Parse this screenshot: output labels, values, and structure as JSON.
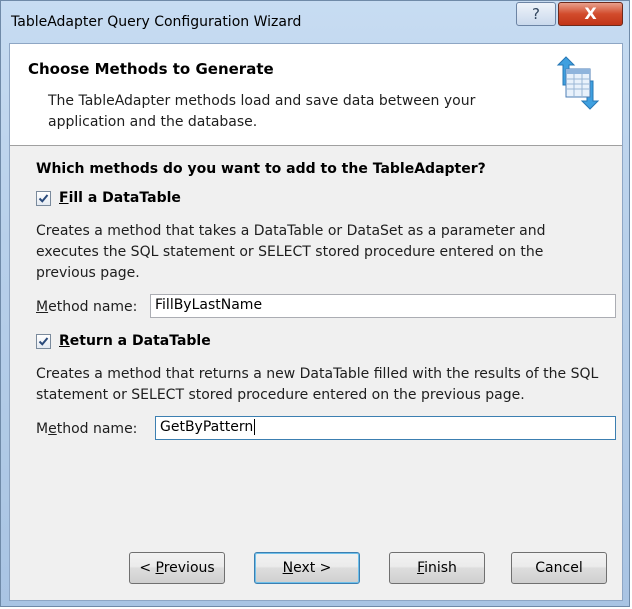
{
  "window": {
    "title": "TableAdapter Query Configuration Wizard",
    "help_glyph": "?",
    "close_glyph": "X"
  },
  "header": {
    "title": "Choose Methods to Generate",
    "description": "The TableAdapter methods load and save data between your application and the database."
  },
  "body": {
    "question": "Which methods do you want to add to the TableAdapter?",
    "fill": {
      "checked": true,
      "label_accel": "F",
      "label_rest": "ill a DataTable",
      "description": "Creates a method that takes a DataTable or DataSet as a parameter and executes the SQL statement or SELECT stored procedure entered on the previous page.",
      "method_label_accel": "M",
      "method_label_rest": "ethod name:",
      "method_value": "FillByLastName"
    },
    "return": {
      "checked": true,
      "label_accel": "R",
      "label_rest": "eturn a DataTable",
      "description": "Creates a method that returns a new DataTable filled with the results of the SQL statement or SELECT stored procedure entered on the previous page.",
      "method_label_pre": "M",
      "method_label_accel": "e",
      "method_label_rest": "thod name:",
      "method_value": "GetByPattern"
    }
  },
  "buttons": {
    "previous": {
      "pre": "< ",
      "accel": "P",
      "rest": "revious"
    },
    "next": {
      "accel": "N",
      "rest": "ext >"
    },
    "finish": {
      "accel": "F",
      "rest": "inish"
    },
    "cancel": "Cancel"
  },
  "colors": {
    "accent": "#3c7fb1",
    "close": "#c13417"
  }
}
